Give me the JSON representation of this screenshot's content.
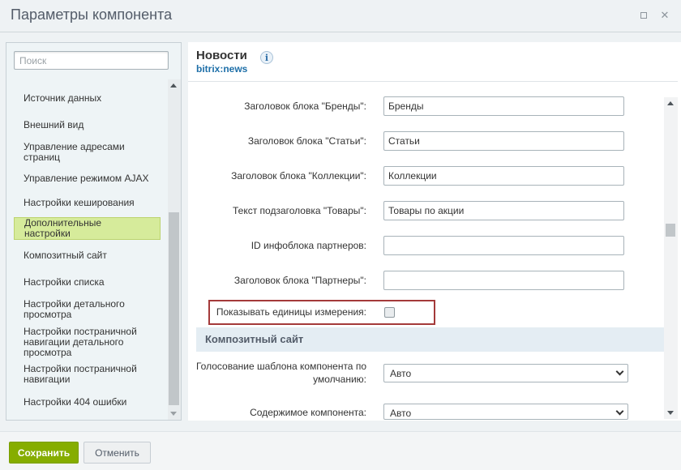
{
  "window": {
    "title": "Параметры компонента"
  },
  "sidebar": {
    "search_placeholder": "Поиск",
    "items": [
      {
        "label": "Источник данных"
      },
      {
        "label": "Внешний вид"
      },
      {
        "label": "Управление адресами страниц"
      },
      {
        "label": "Управление режимом AJAX"
      },
      {
        "label": "Настройки кеширования"
      },
      {
        "label": "Дополнительные настройки",
        "active": true
      },
      {
        "label": "Композитный сайт"
      },
      {
        "label": "Настройки списка"
      },
      {
        "label": "Настройки детального просмотра"
      },
      {
        "label": "Настройки постраничной навигации детального просмотра"
      },
      {
        "label": "Настройки постраничной навигации"
      },
      {
        "label": "Настройки 404 ошибки"
      }
    ]
  },
  "component": {
    "title": "Новости",
    "code": "bitrix:news",
    "info_icon": "i"
  },
  "fields": [
    {
      "label": "Заголовок блока \"Бренды\":",
      "value": "Бренды"
    },
    {
      "label": "Заголовок блока \"Статьи\":",
      "value": "Статьи"
    },
    {
      "label": "Заголовок блока \"Коллекции\":",
      "value": "Коллекции"
    },
    {
      "label": "Текст подзаголовка \"Товары\":",
      "value": "Товары по акции"
    },
    {
      "label": "ID инфоблока партнеров:",
      "value": ""
    },
    {
      "label": "Заголовок блока \"Партнеры\":",
      "value": ""
    }
  ],
  "checkbox_field": {
    "label": "Показывать единицы измерения:",
    "checked": false
  },
  "section": {
    "title": "Композитный сайт"
  },
  "selects": [
    {
      "label": "Голосование шаблона компонента по умолчанию:",
      "value": "Авто"
    },
    {
      "label": "Содержимое компонента:",
      "value": "Авто"
    }
  ],
  "footer": {
    "save_label": "Сохранить",
    "cancel_label": "Отменить"
  },
  "colors": {
    "save_button": "#86ad00",
    "active_item": "#d6eb9b",
    "highlight_border": "#a43a3a",
    "code_link": "#1e6fa8"
  }
}
